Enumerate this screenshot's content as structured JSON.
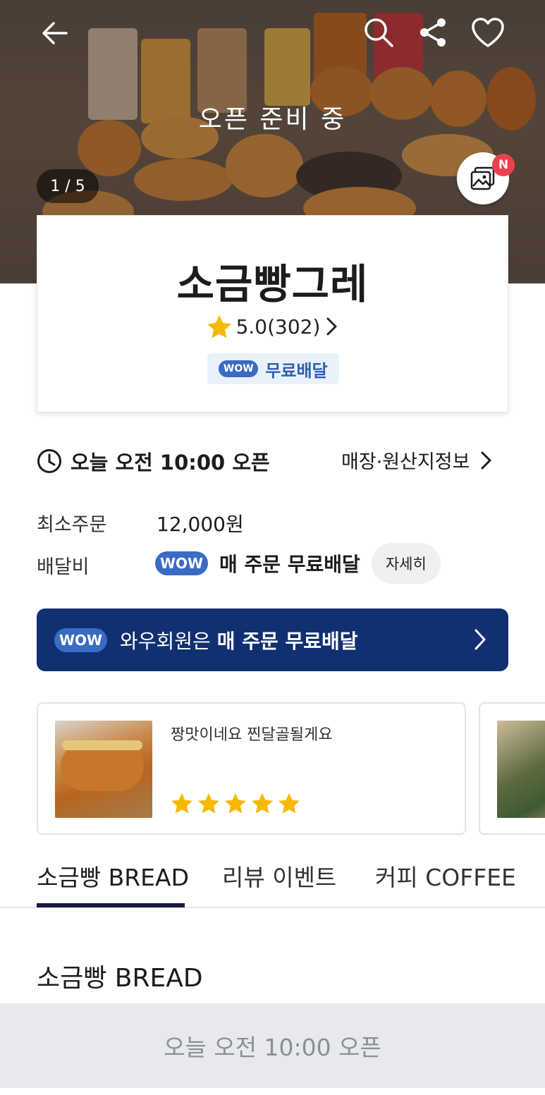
{
  "hero": {
    "status_title": "오픈 준비 중",
    "page_counter": "1 / 5",
    "new_badge": "N"
  },
  "store": {
    "name": "소금빵그레",
    "rating": "5.0(302)",
    "wow_label": "WOW",
    "free_delivery_label": "무료배달"
  },
  "info": {
    "open_time": "오늘 오전 10:00 오픈",
    "store_info_link": "매장·원산지정보",
    "min_order_label": "최소주문",
    "min_order_value": "12,000원",
    "delivery_fee_label": "배달비",
    "wow_label": "WOW",
    "delivery_fee_value": "매 주문 무료배달",
    "detail_button": "자세히"
  },
  "banner": {
    "wow_label": "WOW",
    "text_prefix": "와우회원은 ",
    "text_bold": "매 주문 무료배달"
  },
  "reviews": [
    {
      "text": "짱맛이네요 찐달골될게요",
      "stars": 5
    }
  ],
  "tabs": [
    {
      "label": "소금빵 BREAD",
      "active": true
    },
    {
      "label": "리뷰 이벤트",
      "active": false
    },
    {
      "label": "커피 COFFEE",
      "active": false
    }
  ],
  "section_title": "소금빵 BREAD",
  "bottom_button": "오늘 오전 10:00 오픈",
  "colors": {
    "wow_blue": "#3a6bc4",
    "banner_navy": "#103072",
    "star_yellow": "#f7b801",
    "badge_red": "#ef3f4f"
  }
}
